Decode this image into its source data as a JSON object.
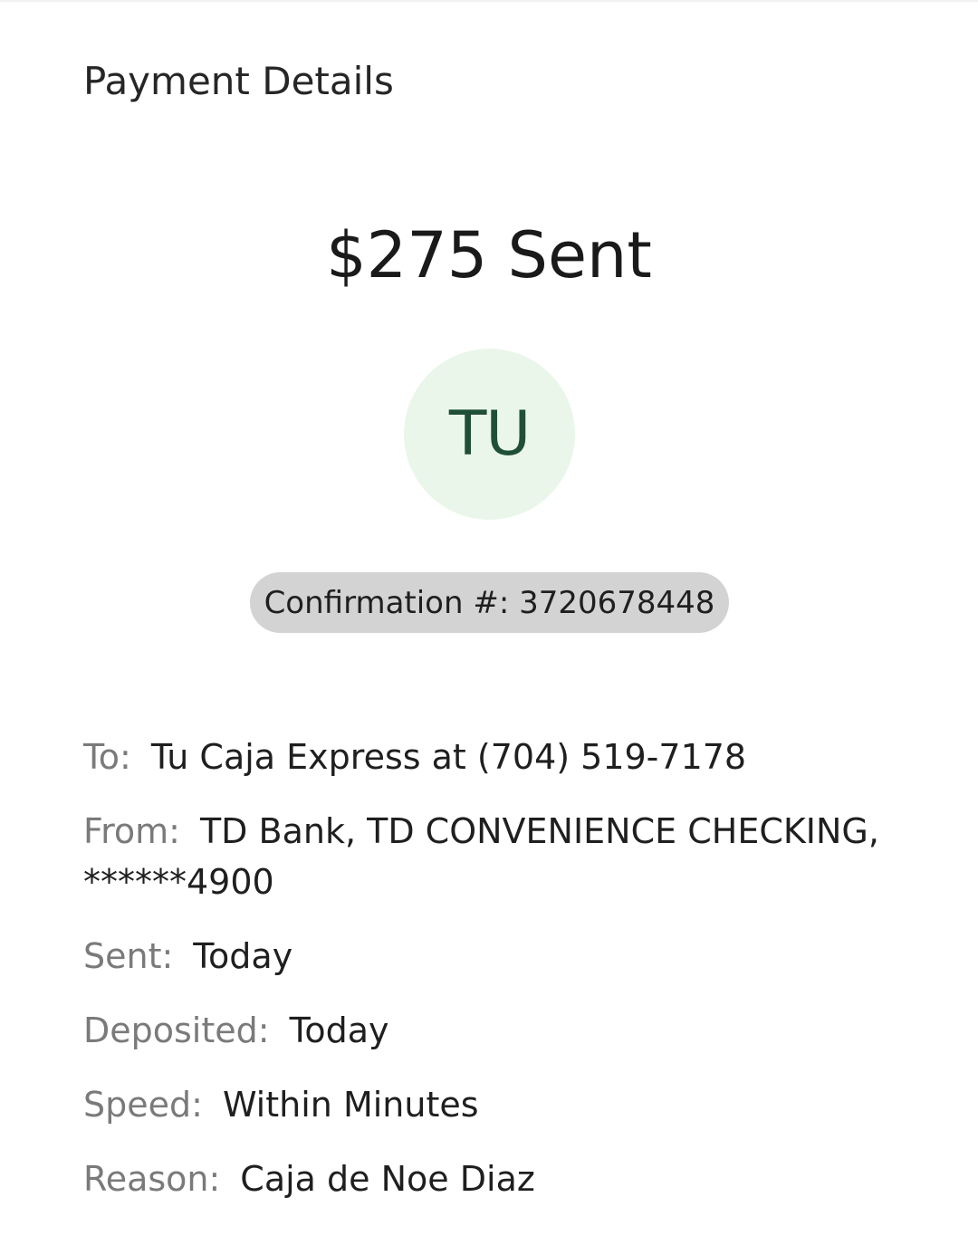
{
  "header": {
    "title": "Payment Details"
  },
  "summary": {
    "amount_text": "$275 Sent",
    "avatar_initials": "TU",
    "confirmation_label": "Confirmation #:",
    "confirmation_number": "3720678448"
  },
  "details": [
    {
      "label": "To:",
      "value": "Tu Caja Express at (704) 519-7178"
    },
    {
      "label": "From:",
      "value": "TD Bank, TD CONVENIENCE CHECKING, ******4900"
    },
    {
      "label": "Sent:",
      "value": "Today"
    },
    {
      "label": "Deposited:",
      "value": "Today"
    },
    {
      "label": "Speed:",
      "value": "Within Minutes"
    },
    {
      "label": "Reason:",
      "value": "Caja de Noe Diaz"
    }
  ],
  "colors": {
    "avatar_bg": "#ebf6ea",
    "avatar_text": "#1f5036",
    "pill_bg": "#d3d3d3",
    "label_text": "#7a7a7a"
  }
}
